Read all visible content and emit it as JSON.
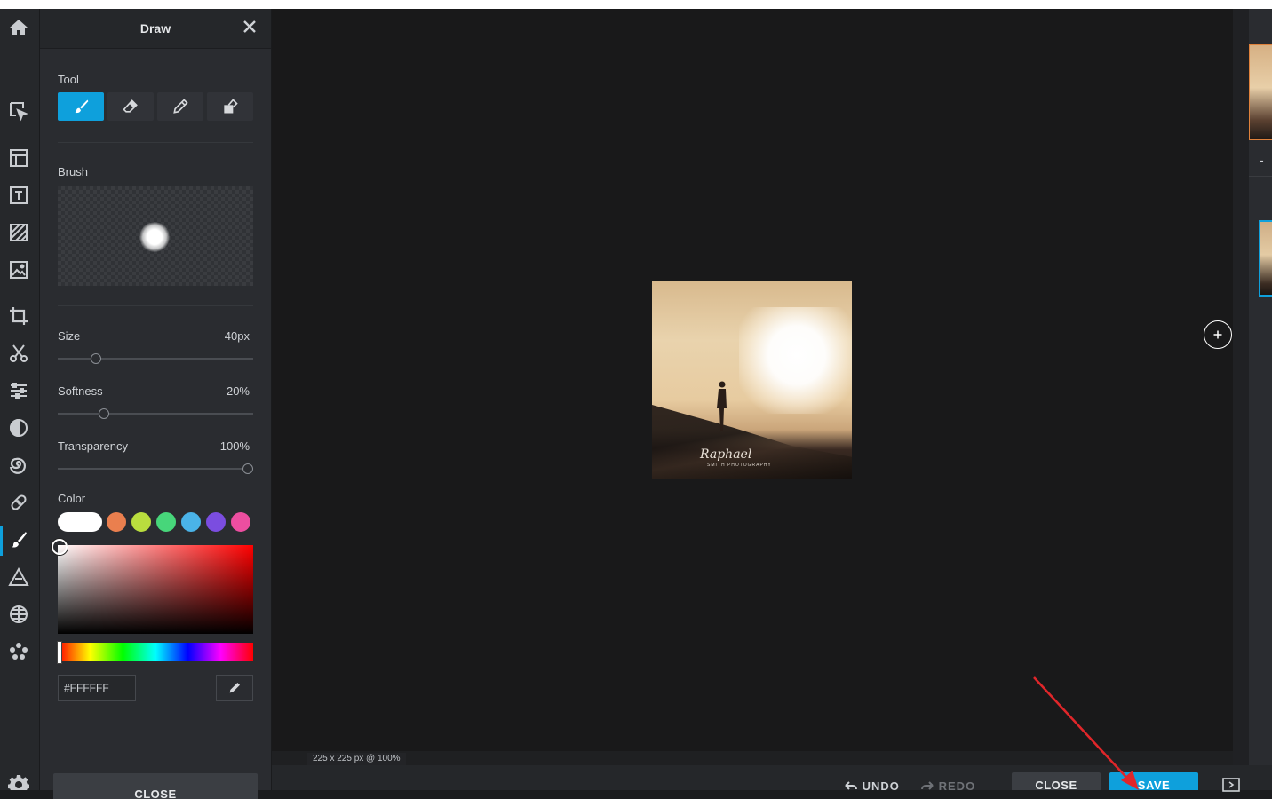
{
  "panel": {
    "title": "Draw",
    "tool_label": "Tool",
    "brush_label": "Brush",
    "size_label": "Size",
    "size_value": "40px",
    "softness_label": "Softness",
    "softness_value": "20%",
    "transparency_label": "Transparency",
    "transparency_value": "100%",
    "color_label": "Color",
    "hex_value": "#FFFFFF",
    "close_label": "CLOSE"
  },
  "sliders": {
    "size": 0.18,
    "softness": 0.22,
    "transparency": 1.0
  },
  "swatches": [
    "#ffffff",
    "#ea7f4e",
    "#b9dd3e",
    "#47d67a",
    "#4ab3e8",
    "#7b4de0",
    "#ec4ea0"
  ],
  "photo": {
    "signature": "Raphael",
    "subtext": "SMITH PHOTOGRAPHY"
  },
  "status": {
    "dimensions": "225 x 225 px @ 100%"
  },
  "bottom": {
    "undo_label": "UNDO",
    "redo_label": "REDO",
    "close_label": "CLOSE",
    "save_label": "SAVE"
  },
  "layers": {
    "minus": "-"
  },
  "colors": {
    "accent": "#0ea0dc",
    "annotation_arrow": "#e0262a"
  }
}
